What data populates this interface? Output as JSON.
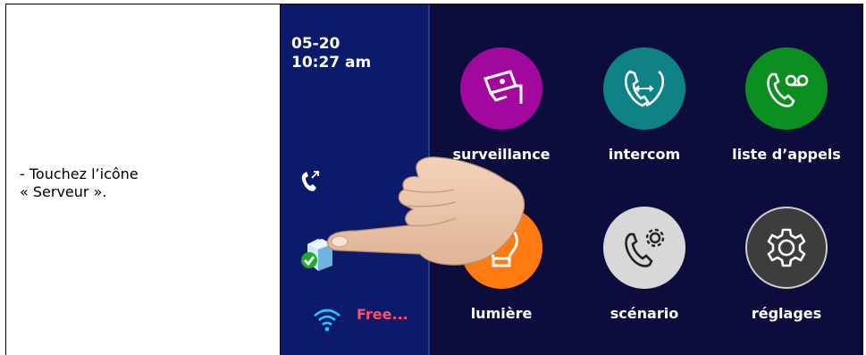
{
  "instruction": {
    "line1": "- Touchez l’icône",
    "line2": "« Serveur »."
  },
  "status": {
    "date": "05-20",
    "time": "10:27 am",
    "wifi_label": "Free..."
  },
  "tiles": [
    {
      "label": "surveillance",
      "color": "#a2089e",
      "icon": "cctv-camera-icon"
    },
    {
      "label": "intercom",
      "color": "#0f8285",
      "icon": "intercom-icon"
    },
    {
      "label": "liste d’appels",
      "color": "#0b8f20",
      "icon": "voicemail-phone-icon"
    },
    {
      "label": "lumière",
      "color": "#ff7a10",
      "icon": "light-bulb-icon"
    },
    {
      "label": "scénario",
      "color": "#d8d8d8",
      "icon": "phone-settings-icon"
    },
    {
      "label": "réglages",
      "color": "#3d3d3d",
      "icon": "gear-icon"
    }
  ]
}
